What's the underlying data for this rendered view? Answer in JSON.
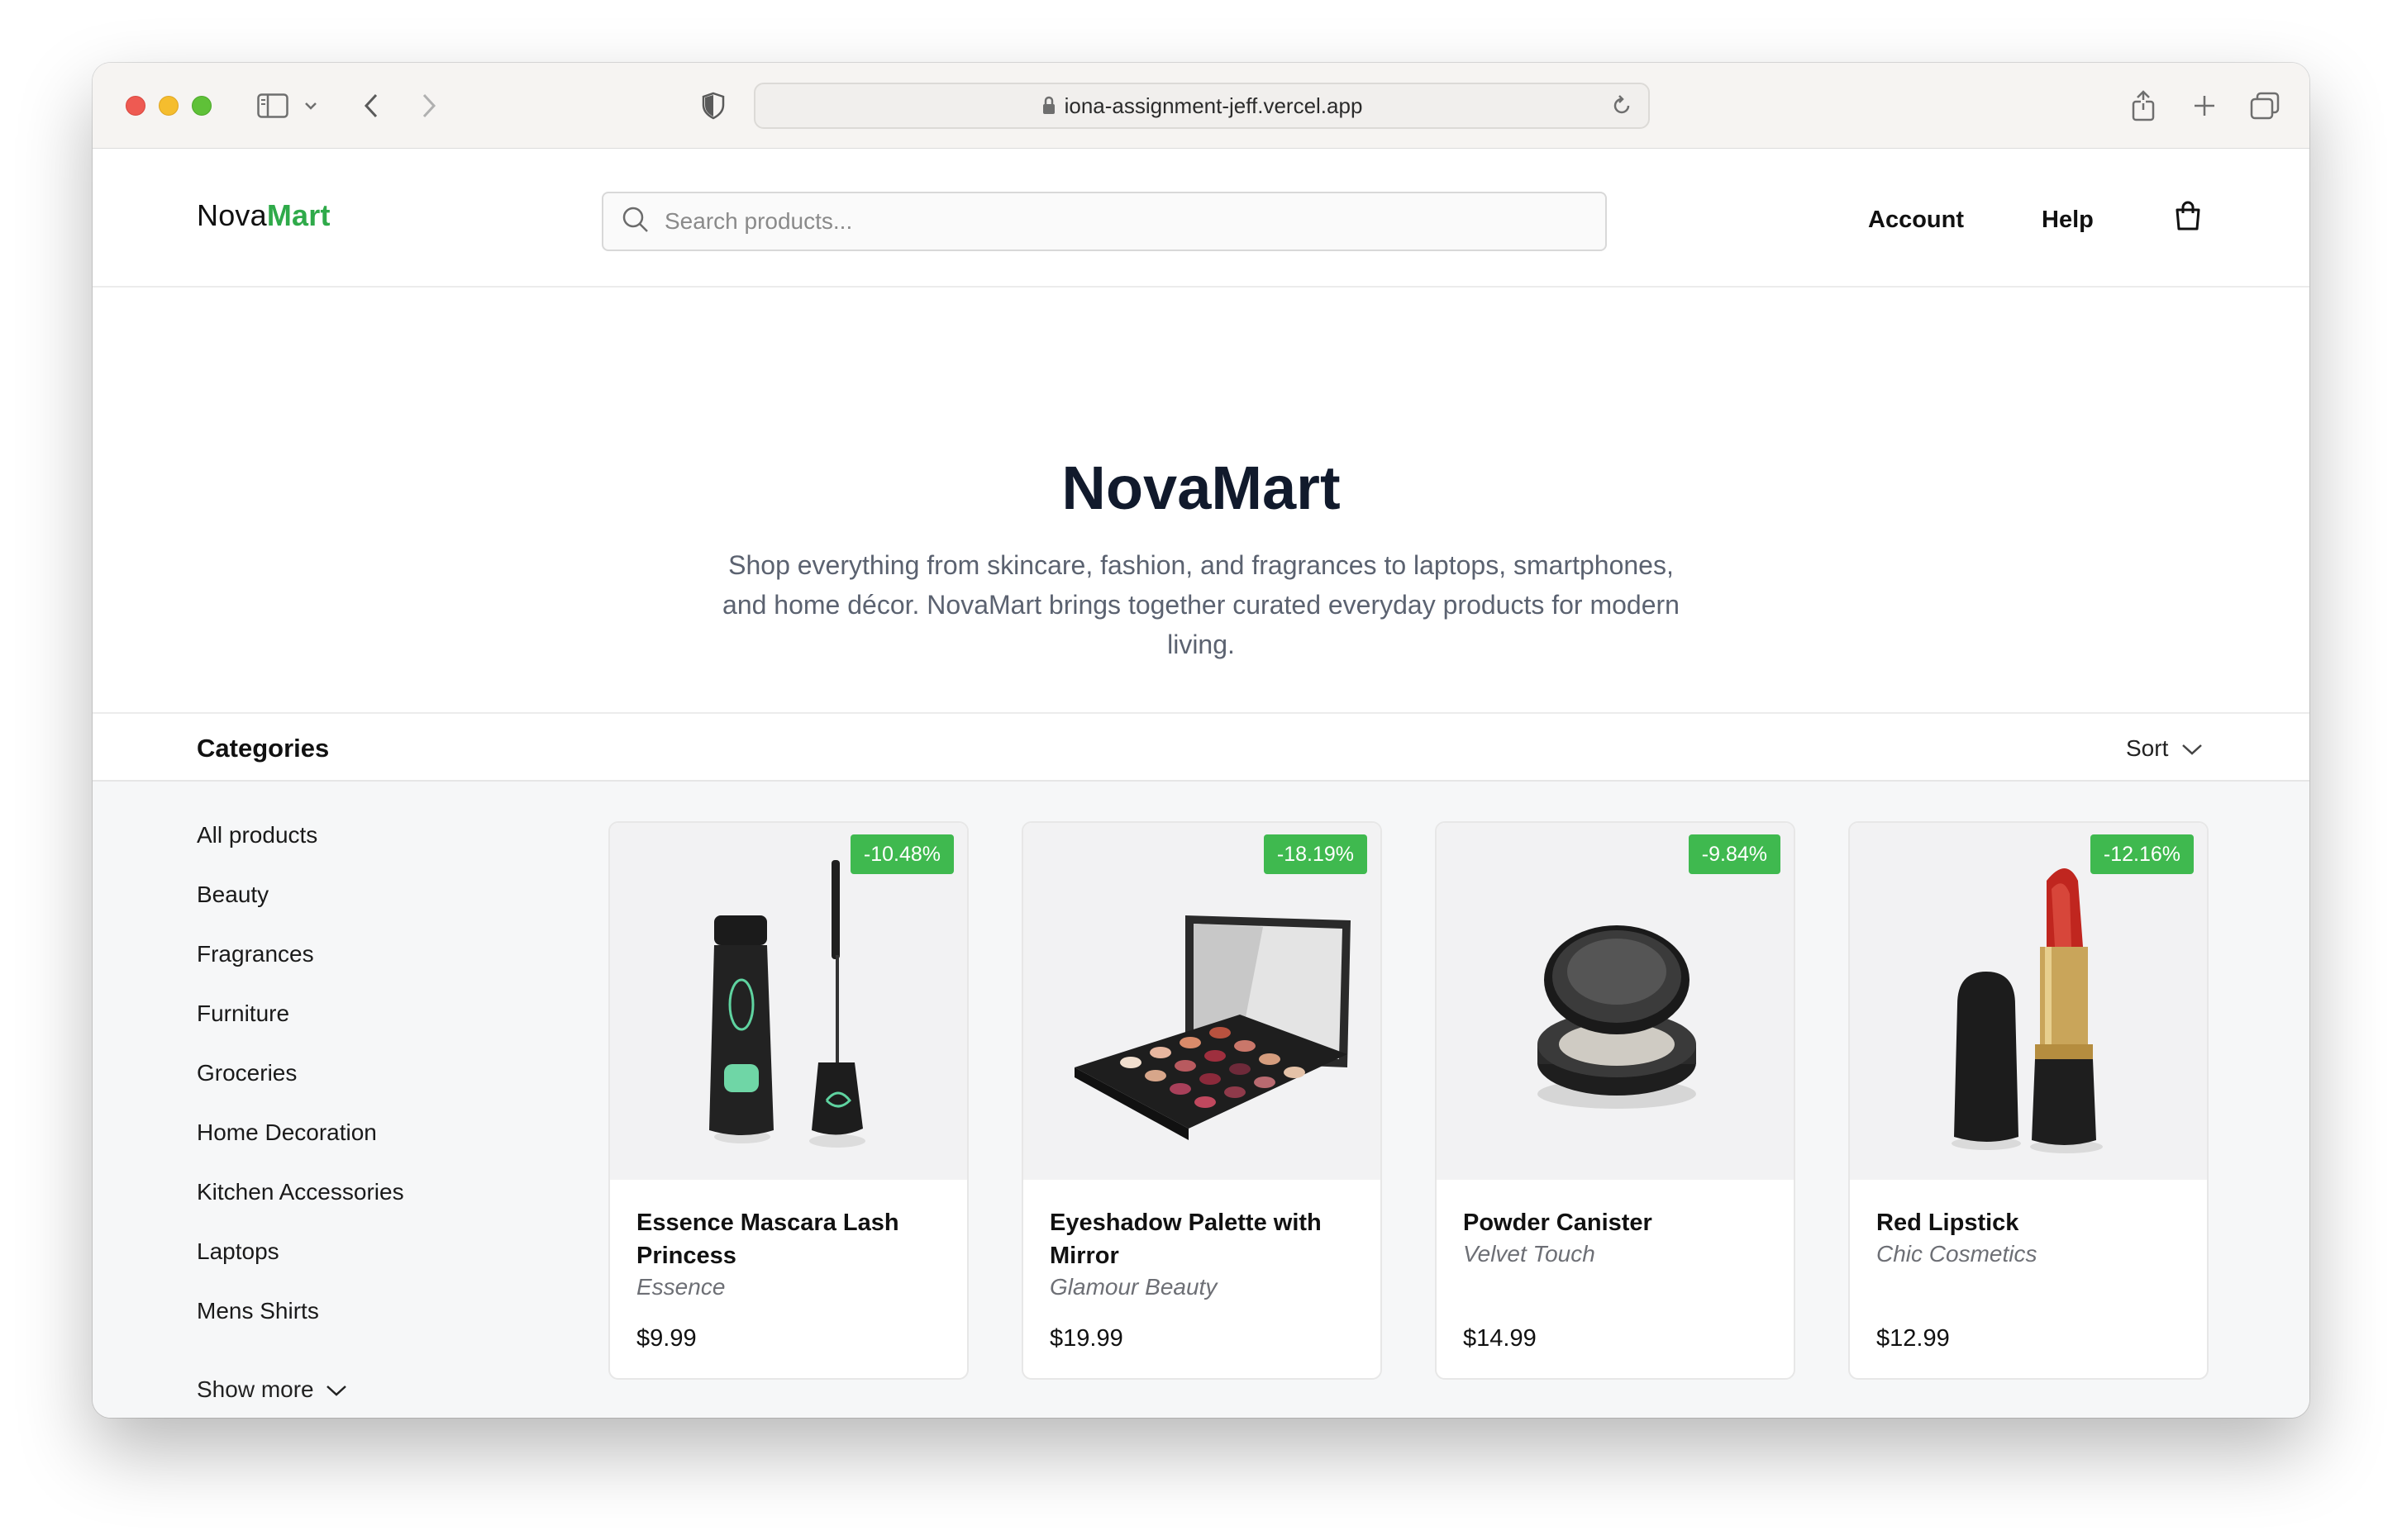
{
  "browser": {
    "url": "iona-assignment-jeff.vercel.app"
  },
  "header": {
    "logo_part1": "Nova",
    "logo_part2": "Mart",
    "search_placeholder": "Search products...",
    "nav": [
      "Account",
      "Help"
    ]
  },
  "hero": {
    "title": "NovaMart",
    "description": "Shop everything from skincare, fashion, and fragrances to laptops, smartphones, and home décor. NovaMart brings together curated everyday products for modern living."
  },
  "categories_bar": {
    "title": "Categories",
    "sort_label": "Sort"
  },
  "sidebar": {
    "categories": [
      "All products",
      "Beauty",
      "Fragrances",
      "Furniture",
      "Groceries",
      "Home Decoration",
      "Kitchen Accessories",
      "Laptops",
      "Mens Shirts"
    ],
    "show_more": "Show more"
  },
  "products": [
    {
      "name": "Essence Mascara Lash Princess",
      "brand": "Essence",
      "price": "$9.99",
      "discount": "-10.48%"
    },
    {
      "name": "Eyeshadow Palette with Mirror",
      "brand": "Glamour Beauty",
      "price": "$19.99",
      "discount": "-18.19%"
    },
    {
      "name": "Powder Canister",
      "brand": "Velvet Touch",
      "price": "$14.99",
      "discount": "-9.84%"
    },
    {
      "name": "Red Lipstick",
      "brand": "Chic Cosmetics",
      "price": "$12.99",
      "discount": "-12.16%"
    }
  ],
  "colors": {
    "accent": "#2faa4a",
    "badge": "#3fb94f",
    "hero_title": "#111a2c"
  }
}
